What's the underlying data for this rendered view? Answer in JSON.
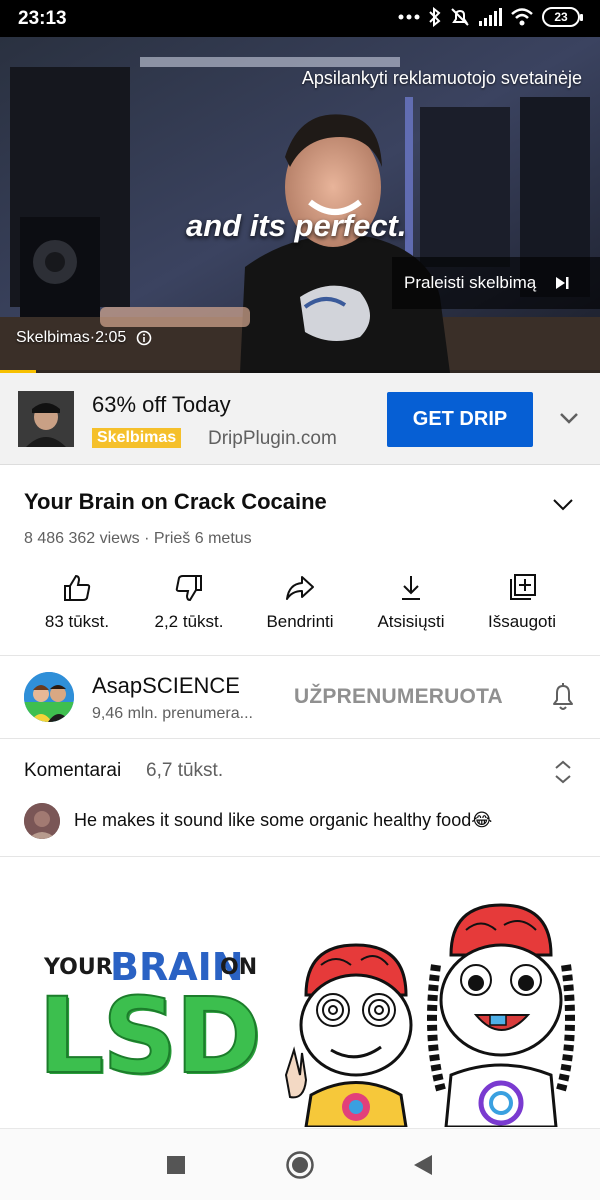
{
  "status_bar": {
    "time": "23:13",
    "battery": "23",
    "icons": [
      "dots-icon",
      "bluetooth-icon",
      "mute-icon",
      "signal-icon",
      "wifi-icon",
      "battery-icon"
    ]
  },
  "video": {
    "visit_site": "Apsilankyti reklamuotojo svetainėje",
    "caption": "and its perfect.",
    "skip_ad": "Praleisti skelbimą",
    "ad_timer": "Skelbimas·2:05",
    "progress": 0.06
  },
  "ad": {
    "title": "63% off Today",
    "badge": "Skelbimas",
    "domain": "DripPlugin.com",
    "cta": "GET DRIP",
    "badge_color": "#f5c02b",
    "cta_color": "#065fd4"
  },
  "details": {
    "title": "Your Brain on Crack Cocaine",
    "meta": "8 486 362 views · Prieš 6 metus"
  },
  "actions": [
    {
      "label": "83 tūkst.",
      "icon": "thumbs-up-icon"
    },
    {
      "label": "2,2 tūkst.",
      "icon": "thumbs-down-icon"
    },
    {
      "label": "Bendrinti",
      "icon": "share-icon"
    },
    {
      "label": "Atsisiųsti",
      "icon": "download-icon"
    },
    {
      "label": "Išsaugoti",
      "icon": "save-playlist-icon"
    }
  ],
  "channel": {
    "name": "AsapSCIENCE",
    "subscribers": "9,46 mln. prenumera...",
    "subscribe_label": "UŽPRENUMERUOTA"
  },
  "comments": {
    "title": "Komentarai",
    "count": "6,7 tūkst.",
    "top_comment": "He makes it sound like some organic healthy food😂"
  },
  "next_video": {
    "thumb_text_1": "YOUR",
    "thumb_text_2": "BRAIN",
    "thumb_text_3": "ON",
    "thumb_text_4": "LSD"
  }
}
